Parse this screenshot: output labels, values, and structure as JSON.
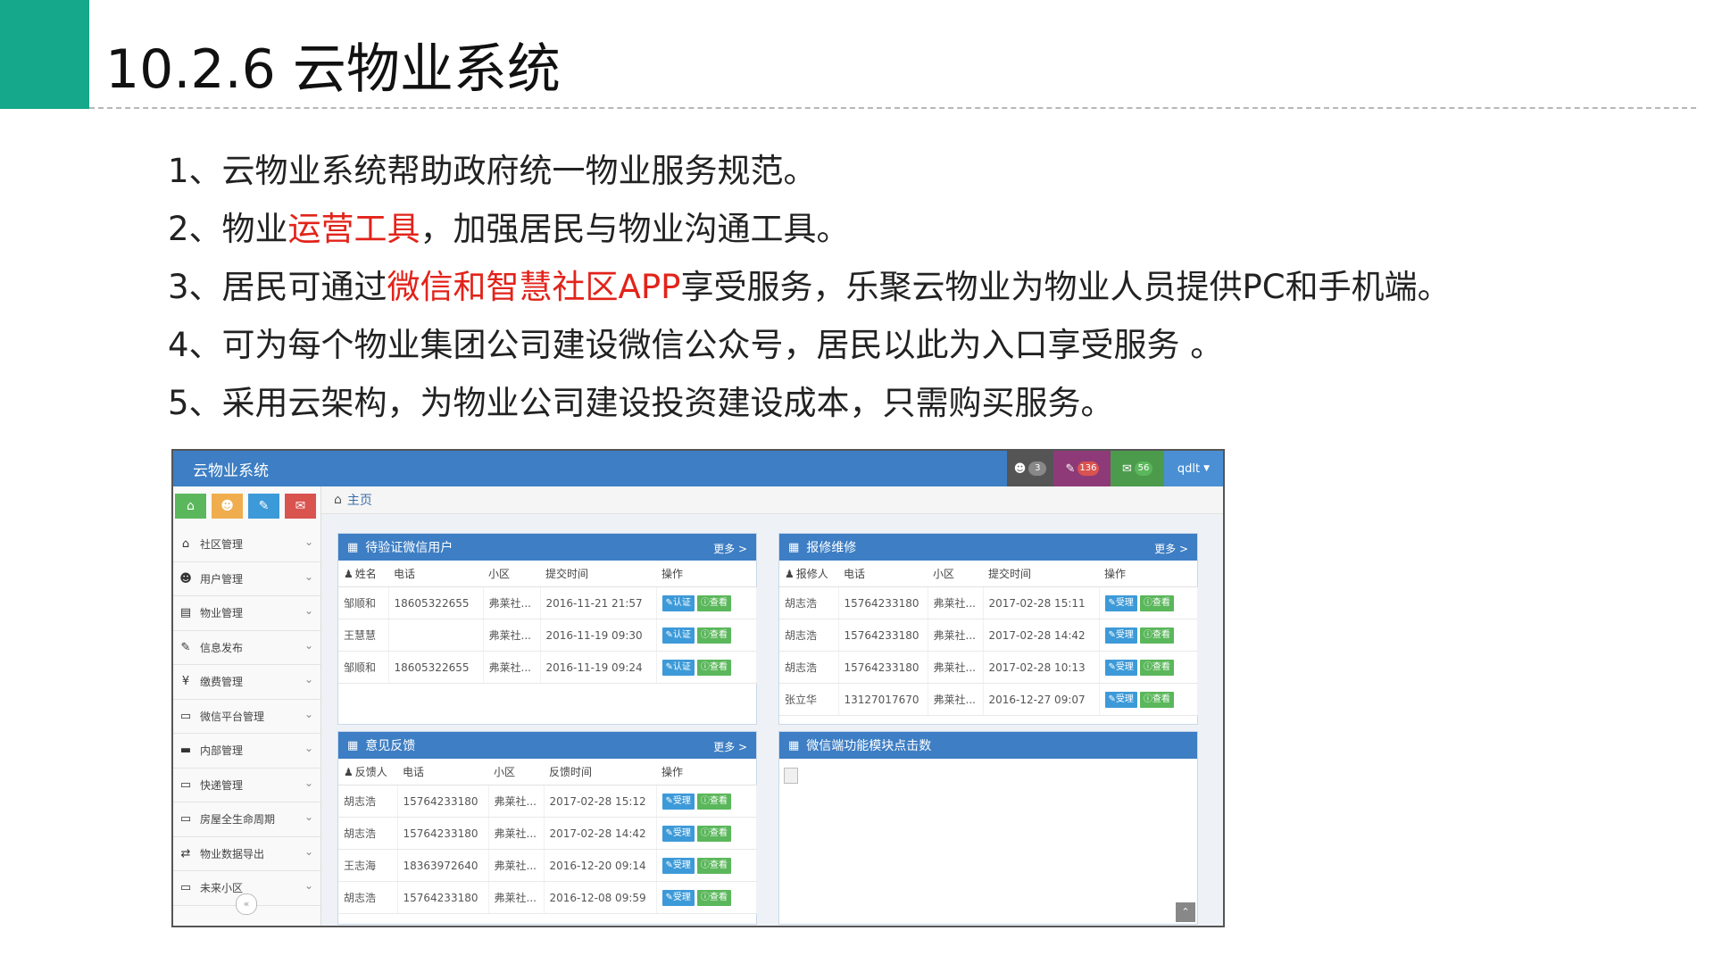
{
  "slide": {
    "title": "10.2.6  云物业系统",
    "points": [
      {
        "pre": "1、云物业系统帮助政府统一物业服务规范。",
        "red": "",
        "post": ""
      },
      {
        "pre": "2、物业",
        "red": "运营工具",
        "post": "，加强居民与物业沟通工具。"
      },
      {
        "pre": "3、居民可通过",
        "red": "微信和智慧社区APP",
        "post": "享受服务，乐聚云物业为物业人员提供PC和手机端。"
      },
      {
        "pre": "4、可为每个物业集团公司建设微信公众号，居民以此为入口享受服务 。",
        "red": "",
        "post": ""
      },
      {
        "pre": "5、采用云架构，为物业公司建设投资建设成本，只需购买服务。",
        "red": "",
        "post": ""
      }
    ]
  },
  "app": {
    "title": "云物业系统",
    "topbar": {
      "users_badge": "3",
      "tasks_badge": "136",
      "mail_badge": "56",
      "user_name": "qdlt",
      "colors": {
        "users": "#555555",
        "tasks": "#8e3a78",
        "mail": "#4c9b4c",
        "user": "#4a8fd4"
      }
    },
    "shortcut_colors": [
      "#5bb75b",
      "#f0ad4e",
      "#3d9ad8",
      "#d9534f"
    ],
    "sidebar": [
      {
        "icon": "home-icon",
        "glyph": "⌂",
        "label": "社区管理"
      },
      {
        "icon": "users-icon",
        "glyph": "☻",
        "label": "用户管理"
      },
      {
        "icon": "list-icon",
        "glyph": "▤",
        "label": "物业管理"
      },
      {
        "icon": "edit-icon",
        "glyph": "✎",
        "label": "信息发布"
      },
      {
        "icon": "yen-icon",
        "glyph": "¥",
        "label": "缴费管理"
      },
      {
        "icon": "desktop-icon",
        "glyph": "▭",
        "label": "微信平台管理"
      },
      {
        "icon": "folder-icon",
        "glyph": "▬",
        "label": "内部管理"
      },
      {
        "icon": "desktop-icon",
        "glyph": "▭",
        "label": "快递管理"
      },
      {
        "icon": "desktop-icon",
        "glyph": "▭",
        "label": "房屋全生命周期"
      },
      {
        "icon": "exchange-icon",
        "glyph": "⇄",
        "label": "物业数据导出"
      },
      {
        "icon": "desktop-icon",
        "glyph": "▭",
        "label": "未来小区"
      }
    ],
    "breadcrumb": "主页",
    "more": "更多 >",
    "wechat_panel": {
      "title": "待验证微信用户",
      "headers": [
        "姓名",
        "电话",
        "小区",
        "提交时间",
        "操作"
      ],
      "rows": [
        {
          "name": "邹顺和",
          "phone": "18605322655",
          "area": "弗莱社...",
          "time": "2016-11-21 21:57"
        },
        {
          "name": "王慧慧",
          "phone": "",
          "area": "弗莱社...",
          "time": "2016-11-19 09:30"
        },
        {
          "name": "邹顺和",
          "phone": "18605322655",
          "area": "弗莱社...",
          "time": "2016-11-19 09:24"
        }
      ],
      "btn_a": "认证",
      "btn_b": "查看"
    },
    "repair_panel": {
      "title": "报修维修",
      "headers": [
        "报修人",
        "电话",
        "小区",
        "提交时间",
        "操作"
      ],
      "rows": [
        {
          "name": "胡志浩",
          "phone": "15764233180",
          "area": "弗莱社...",
          "time": "2017-02-28 15:11"
        },
        {
          "name": "胡志浩",
          "phone": "15764233180",
          "area": "弗莱社...",
          "time": "2017-02-28 14:42"
        },
        {
          "name": "胡志浩",
          "phone": "15764233180",
          "area": "弗莱社...",
          "time": "2017-02-28 10:13"
        },
        {
          "name": "张立华",
          "phone": "13127017670",
          "area": "弗莱社...",
          "time": "2016-12-27 09:07"
        }
      ],
      "btn_a": "受理",
      "btn_b": "查看"
    },
    "feedback_panel": {
      "title": "意见反馈",
      "headers": [
        "反馈人",
        "电话",
        "小区",
        "反馈时间",
        "操作"
      ],
      "rows": [
        {
          "name": "胡志浩",
          "phone": "15764233180",
          "area": "弗莱社...",
          "time": "2017-02-28 15:12"
        },
        {
          "name": "胡志浩",
          "phone": "15764233180",
          "area": "弗莱社...",
          "time": "2017-02-28 14:42"
        },
        {
          "name": "王志海",
          "phone": "18363972640",
          "area": "弗莱社...",
          "time": "2016-12-20 09:14"
        },
        {
          "name": "胡志浩",
          "phone": "15764233180",
          "area": "弗莱社...",
          "time": "2016-12-08 09:59"
        }
      ],
      "btn_a": "受理",
      "btn_b": "查看"
    },
    "clicks_panel": {
      "title": "微信端功能模块点击数"
    }
  }
}
